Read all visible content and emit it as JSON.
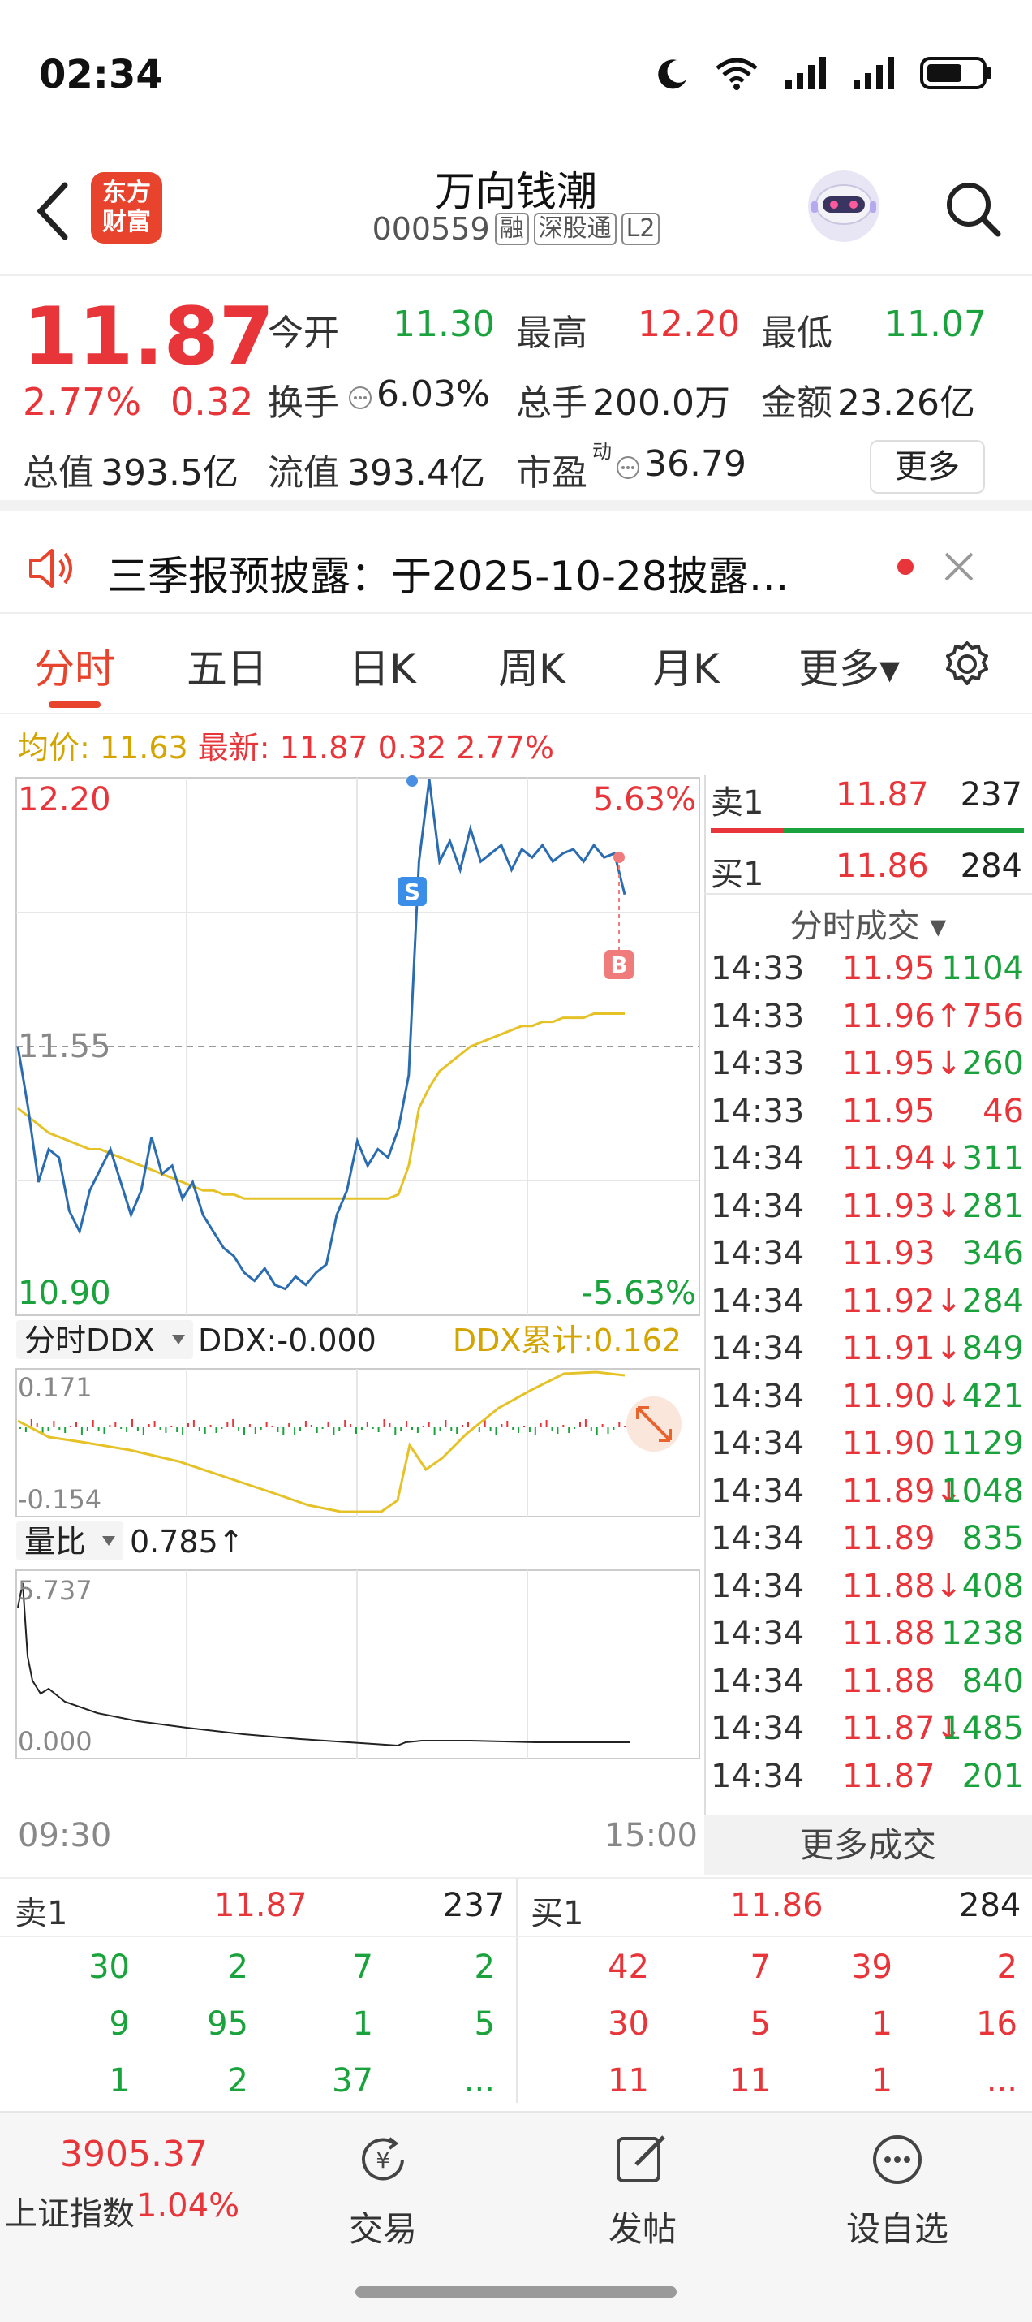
{
  "status_bar": {
    "time": "02:34",
    "wifi_badge": "6"
  },
  "header": {
    "stock_name": "万向钱潮",
    "stock_code": "000559",
    "tags": [
      "融",
      "深股通",
      "L2"
    ],
    "logo_text_line1": "东方",
    "logo_text_line2": "财富"
  },
  "quote": {
    "last_price": "11.87",
    "change_pct": "2.77%",
    "change_amt": "0.32",
    "open_label": "今开",
    "open": "11.30",
    "high_label": "最高",
    "high": "12.20",
    "low_label": "最低",
    "low": "11.07",
    "turnover_label": "换手",
    "turnover": "6.03%",
    "volume_label": "总手",
    "volume": "200.0万",
    "amount_label": "金额",
    "amount": "23.26亿",
    "mktcap_label": "总值",
    "mktcap": "393.5亿",
    "float_label": "流值",
    "float_cap": "393.4亿",
    "pe_label": "市盈",
    "pe_sup": "动",
    "pe": "36.79",
    "more_label": "更多"
  },
  "notice": {
    "text": "三季报预披露：于2025-10-28披露…"
  },
  "tabs": [
    "分时",
    "五日",
    "日K",
    "周K",
    "月K",
    "更多▾"
  ],
  "chart_header": {
    "avg_label": "均价:",
    "avg_value": "11.63",
    "latest_label": "最新:",
    "latest_value": "11.87",
    "latest_change": "0.32",
    "latest_pct": "2.77%"
  },
  "colors": {
    "up": "#e8353a",
    "down": "#1aa33c",
    "accent": "#e8432d",
    "price_line": "#2b6cb0",
    "avg_line": "#e6c229"
  },
  "chart_data": [
    {
      "type": "line",
      "name": "intraday",
      "y_top_label": "12.20",
      "y_mid_label": "11.55",
      "y_bottom_label": "10.90",
      "pct_top_label": "5.63%",
      "pct_bottom_label": "-5.63%",
      "ylim": [
        10.9,
        12.2
      ],
      "x_start_label": "09:30",
      "x_end_label": "15:00",
      "series": [
        {
          "name": "price",
          "values": [
            11.55,
            11.4,
            11.22,
            11.3,
            11.28,
            11.15,
            11.1,
            11.2,
            11.25,
            11.3,
            11.22,
            11.14,
            11.2,
            11.33,
            11.24,
            11.26,
            11.18,
            11.22,
            11.14,
            11.1,
            11.06,
            11.04,
            11.0,
            10.98,
            11.01,
            10.97,
            10.96,
            10.99,
            10.97,
            11.0,
            11.02,
            11.14,
            11.2,
            11.32,
            11.26,
            11.3,
            11.28,
            11.35,
            11.48,
            12.0,
            12.2,
            12.0,
            12.05,
            11.98,
            12.08,
            12.0,
            12.02,
            12.04,
            11.98,
            12.03,
            12.01,
            12.04,
            12.0,
            12.02,
            12.03,
            12.0,
            12.04,
            12.01,
            12.02,
            11.92
          ]
        },
        {
          "name": "avg",
          "values": [
            11.4,
            11.38,
            11.36,
            11.34,
            11.33,
            11.32,
            11.31,
            11.3,
            11.3,
            11.29,
            11.28,
            11.27,
            11.26,
            11.25,
            11.24,
            11.23,
            11.22,
            11.21,
            11.2,
            11.2,
            11.19,
            11.19,
            11.18,
            11.18,
            11.18,
            11.18,
            11.18,
            11.18,
            11.18,
            11.18,
            11.18,
            11.18,
            11.18,
            11.18,
            11.18,
            11.18,
            11.18,
            11.19,
            11.26,
            11.4,
            11.45,
            11.49,
            11.51,
            11.53,
            11.55,
            11.56,
            11.57,
            11.58,
            11.59,
            11.6,
            11.6,
            11.61,
            11.61,
            11.62,
            11.62,
            11.62,
            11.63,
            11.63,
            11.63,
            11.63
          ]
        }
      ],
      "markers": [
        "S",
        "B"
      ]
    },
    {
      "type": "line",
      "name": "DDX",
      "indicator_label": "分时DDX",
      "ddx_value": "DDX:-0.000",
      "ddx_cum": "DDX累计:0.162",
      "y_top_label": "0.171",
      "y_bottom_label": "-0.154",
      "ylim": [
        -0.154,
        0.171
      ]
    },
    {
      "type": "line",
      "name": "volume_ratio",
      "indicator_label": "量比",
      "value": "0.785↑",
      "y_top_label": "5.737",
      "y_bottom_label": "0.000",
      "ylim": [
        0,
        5.737
      ]
    }
  ],
  "level1": {
    "sell_label": "卖1",
    "sell_price": "11.87",
    "sell_vol": "237",
    "buy_label": "买1",
    "buy_price": "11.86",
    "buy_vol": "284"
  },
  "trades_header": "分时成交 ▾",
  "trades": [
    {
      "t": "14:33",
      "p": "11.95",
      "v": "1104",
      "dir": "g"
    },
    {
      "t": "14:33",
      "p": "11.96↑",
      "v": "756",
      "dir": "r"
    },
    {
      "t": "14:33",
      "p": "11.95↓",
      "v": "260",
      "dir": "g"
    },
    {
      "t": "14:33",
      "p": "11.95",
      "v": "46",
      "dir": "r"
    },
    {
      "t": "14:34",
      "p": "11.94↓",
      "v": "311",
      "dir": "g"
    },
    {
      "t": "14:34",
      "p": "11.93↓",
      "v": "281",
      "dir": "g"
    },
    {
      "t": "14:34",
      "p": "11.93",
      "v": "346",
      "dir": "g"
    },
    {
      "t": "14:34",
      "p": "11.92↓",
      "v": "284",
      "dir": "g"
    },
    {
      "t": "14:34",
      "p": "11.91↓",
      "v": "849",
      "dir": "g"
    },
    {
      "t": "14:34",
      "p": "11.90↓",
      "v": "421",
      "dir": "g"
    },
    {
      "t": "14:34",
      "p": "11.90",
      "v": "1129",
      "dir": "g"
    },
    {
      "t": "14:34",
      "p": "11.89↓",
      "v": "1048",
      "dir": "g"
    },
    {
      "t": "14:34",
      "p": "11.89",
      "v": "835",
      "dir": "g"
    },
    {
      "t": "14:34",
      "p": "11.88↓",
      "v": "408",
      "dir": "g"
    },
    {
      "t": "14:34",
      "p": "11.88",
      "v": "1238",
      "dir": "g"
    },
    {
      "t": "14:34",
      "p": "11.88",
      "v": "840",
      "dir": "g"
    },
    {
      "t": "14:34",
      "p": "11.87↓",
      "v": "1485",
      "dir": "g"
    },
    {
      "t": "14:34",
      "p": "11.87",
      "v": "201",
      "dir": "g"
    }
  ],
  "more_trades_label": "更多成交",
  "book": {
    "sell_label": "卖1",
    "sell_price": "11.87",
    "sell_vol": "237",
    "buy_label": "买1",
    "buy_price": "11.86",
    "buy_vol": "284",
    "sell_queue": [
      [
        "30",
        "2",
        "7",
        "2"
      ],
      [
        "9",
        "95",
        "1",
        "5"
      ],
      [
        "1",
        "2",
        "37",
        "..."
      ]
    ],
    "buy_queue": [
      [
        "42",
        "7",
        "39",
        "2"
      ],
      [
        "30",
        "5",
        "1",
        "16"
      ],
      [
        "11",
        "11",
        "1",
        "..."
      ]
    ]
  },
  "bottom_nav": {
    "index_value": "3905.37",
    "index_name": "上证指数",
    "index_pct": "1.04%",
    "trade_label": "交易",
    "post_label": "发帖",
    "watchlist_label": "设自选"
  }
}
